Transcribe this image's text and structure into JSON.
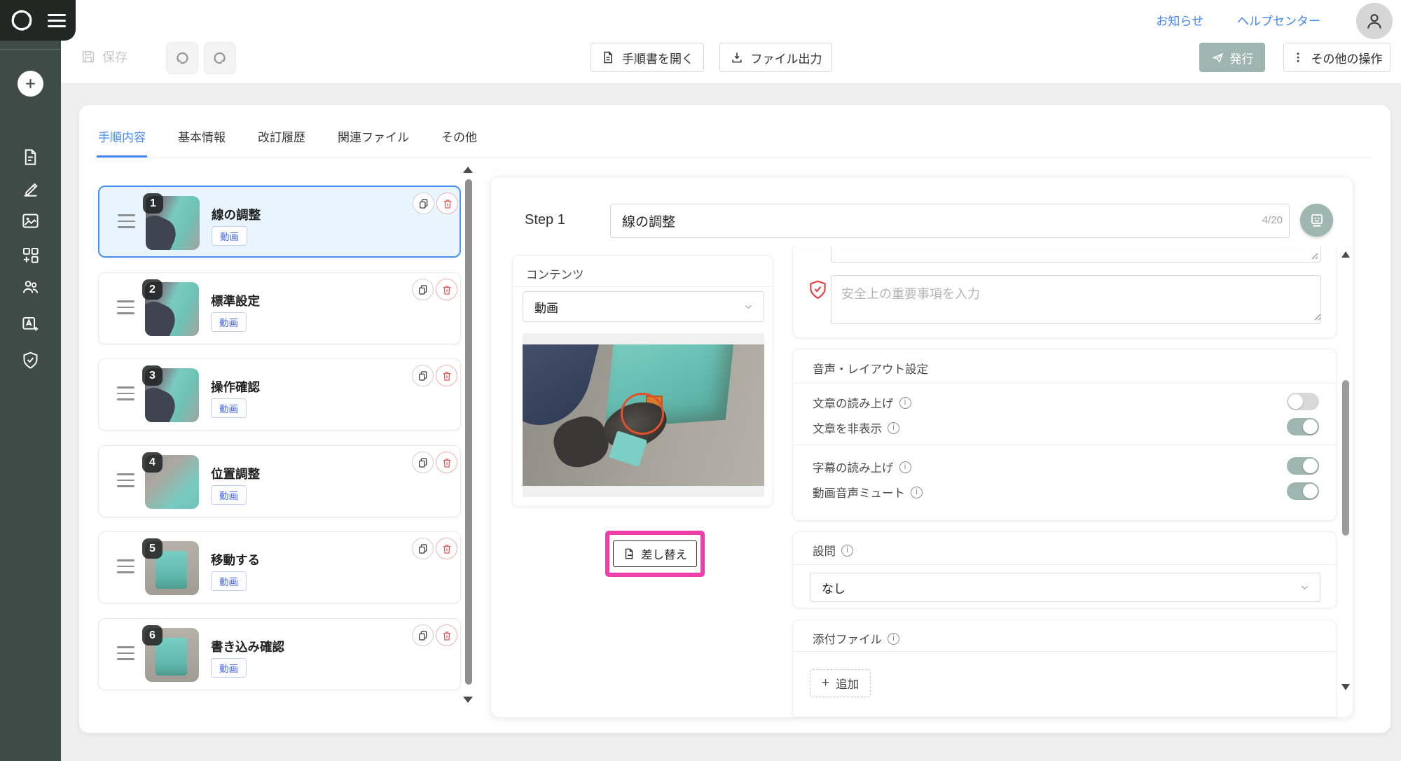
{
  "topbar": {
    "links": [
      {
        "label": "お知らせ"
      },
      {
        "label": "ヘルプセンター"
      }
    ]
  },
  "toolbar": {
    "save_label": "保存",
    "open_manual_label": "手順書を開く",
    "file_export_label": "ファイル出力",
    "publish_label": "発行",
    "more_actions_label": "その他の操作"
  },
  "tabs": [
    {
      "label": "手順内容",
      "active": true
    },
    {
      "label": "基本情報",
      "active": false
    },
    {
      "label": "改訂履歴",
      "active": false
    },
    {
      "label": "関連ファイル",
      "active": false
    },
    {
      "label": "その他",
      "active": false
    }
  ],
  "steps": [
    {
      "num": "1",
      "title": "線の調整",
      "badge": "動画",
      "selected": true
    },
    {
      "num": "2",
      "title": "標準設定",
      "badge": "動画",
      "selected": false
    },
    {
      "num": "3",
      "title": "操作確認",
      "badge": "動画",
      "selected": false
    },
    {
      "num": "4",
      "title": "位置調整",
      "badge": "動画",
      "selected": false
    },
    {
      "num": "5",
      "title": "移動する",
      "badge": "動画",
      "selected": false
    },
    {
      "num": "6",
      "title": "書き込み確認",
      "badge": "動画",
      "selected": false
    }
  ],
  "editor": {
    "step_label": "Step 1",
    "title_value": "線の調整",
    "title_counter": "4/20",
    "content": {
      "header": "コンテンツ",
      "type_value": "動画",
      "replace_label": "差し替え"
    },
    "safety": {
      "placeholder": "安全上の重要事項を入力"
    },
    "audio_layout": {
      "header": "音声・レイアウト設定",
      "rows": [
        {
          "label": "文章の読み上げ",
          "on": false
        },
        {
          "label": "文章を非表示",
          "on": true
        },
        {
          "label": "字幕の読み上げ",
          "on": true
        },
        {
          "label": "動画音声ミュート",
          "on": true
        }
      ]
    },
    "question": {
      "header": "設問",
      "value": "なし"
    },
    "attachments": {
      "header": "添付ファイル",
      "add_label": "追加"
    }
  },
  "icons": {
    "sidebar": [
      "plus-icon",
      "document-icon",
      "pencil-icon",
      "image-icon",
      "widgets-icon",
      "users-icon",
      "translate-icon",
      "shield-check-icon"
    ],
    "other": [
      "swirl-logo",
      "hamburger-icon",
      "floppy-icon",
      "undo-icon",
      "redo-icon",
      "download-icon",
      "send-icon",
      "kebab-icon",
      "copy-icon",
      "trash-icon",
      "chevron-down-icon",
      "info-icon",
      "red-shield-icon",
      "monitor-icon",
      "person-icon",
      "drag-handle-icon"
    ]
  },
  "colors": {
    "accent_blue": "#4285f4",
    "sage_green": "#9eb6af",
    "highlight_pink": "#ec3fa9",
    "danger_red": "#e25555",
    "sidebar_dark": "#3e4b47",
    "selected_item_bg": "#e8f4fe"
  }
}
